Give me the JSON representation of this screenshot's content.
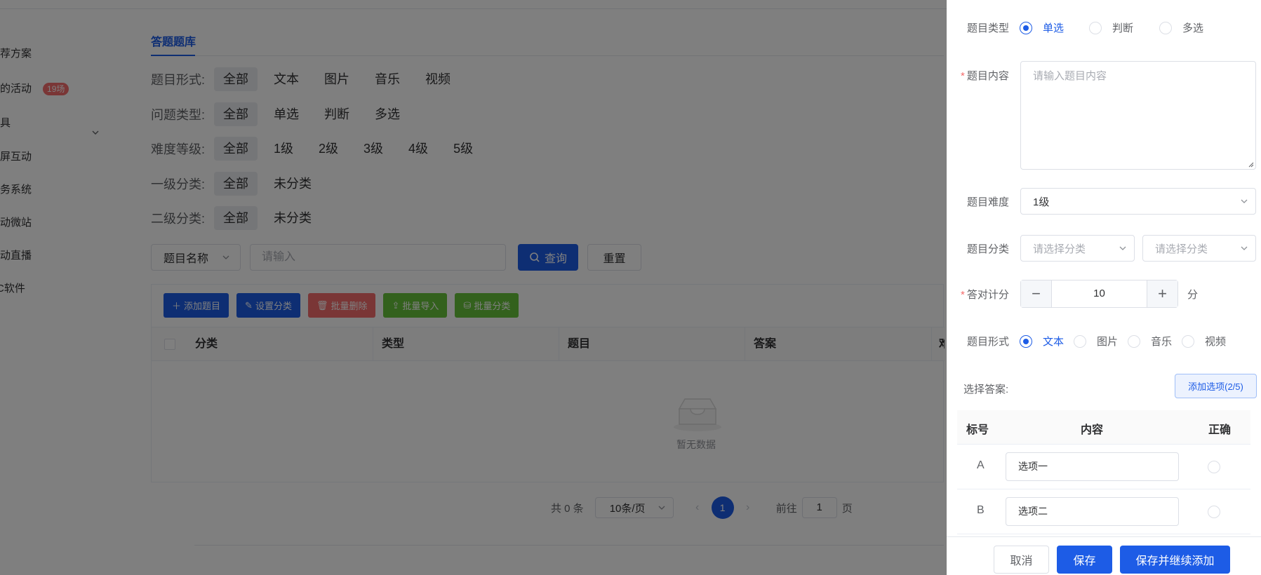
{
  "sidebar": {
    "items": [
      {
        "label": "推荐方案"
      },
      {
        "label": "我的活动",
        "badge": "19场"
      },
      {
        "label": "工具"
      },
      {
        "label": "大屏互动"
      },
      {
        "label": "会务系统"
      },
      {
        "label": "活动微站"
      },
      {
        "label": "活动直播"
      },
      {
        "label": "PC软件"
      }
    ]
  },
  "main": {
    "tab": "答题题库",
    "filters": [
      {
        "label": "题目形式:",
        "options": [
          "全部",
          "文本",
          "图片",
          "音乐",
          "视频"
        ]
      },
      {
        "label": "问题类型:",
        "options": [
          "全部",
          "单选",
          "判断",
          "多选"
        ]
      },
      {
        "label": "难度等级:",
        "options": [
          "全部",
          "1级",
          "2级",
          "3级",
          "4级",
          "5级"
        ]
      },
      {
        "label": "一级分类:",
        "options": [
          "全部",
          "未分类"
        ]
      },
      {
        "label": "二级分类:",
        "options": [
          "全部",
          "未分类"
        ]
      }
    ],
    "search": {
      "field_select": "题目名称",
      "placeholder": "请输入",
      "query_label": "查询",
      "reset_label": "重置"
    },
    "toolbar": {
      "add": "添加题目",
      "set_category": "设置分类",
      "batch_delete": "批量删除",
      "batch_import": "批量导入",
      "batch_category": "批量分类"
    },
    "table": {
      "columns": [
        "分类",
        "类型",
        "题目",
        "答案",
        "难"
      ],
      "empty_text": "暂无数据"
    },
    "pagination": {
      "total": "共 0 条",
      "page_size": "10条/页",
      "current_page": "1",
      "goto_prefix": "前往",
      "goto_value": "1",
      "goto_suffix": "页"
    }
  },
  "drawer": {
    "question_type": {
      "label": "题目类型",
      "options": [
        "单选",
        "判断",
        "多选"
      ],
      "selected": "单选"
    },
    "content": {
      "label": "题目内容",
      "placeholder": "请输入题目内容"
    },
    "difficulty": {
      "label": "题目难度",
      "value": "1级"
    },
    "category": {
      "label": "题目分类",
      "placeholder1": "请选择分类",
      "placeholder2": "请选择分类"
    },
    "score": {
      "label": "答对计分",
      "value": "10",
      "unit": "分"
    },
    "form": {
      "label": "题目形式",
      "options": [
        "文本",
        "图片",
        "音乐",
        "视频"
      ],
      "selected": "文本"
    },
    "answers": {
      "label": "选择答案:",
      "add_label": "添加选项(2/5)",
      "headers": [
        "标号",
        "内容",
        "正确"
      ],
      "rows": [
        {
          "letter": "A",
          "value": "选项一"
        },
        {
          "letter": "B",
          "value": "选项二"
        }
      ]
    },
    "footer": {
      "cancel": "取消",
      "save": "保存",
      "save_continue": "保存并继续添加"
    }
  },
  "colors": {
    "primary": "#1d5ce6",
    "danger": "#f56c6c",
    "success": "#67c23a",
    "overlay": "rgba(0,0,0,0.5)"
  }
}
